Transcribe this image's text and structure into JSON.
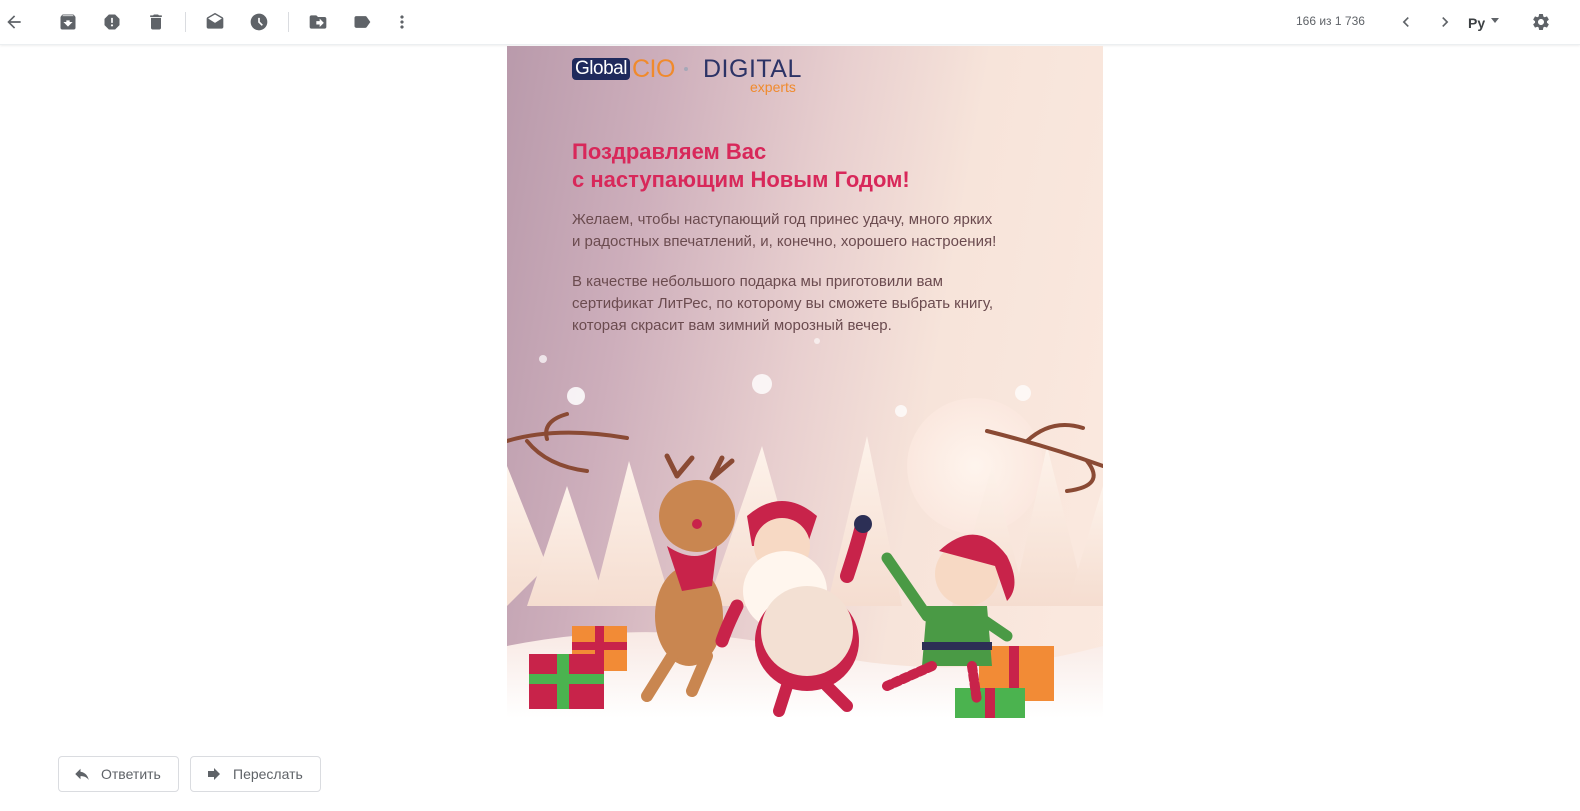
{
  "toolbar": {
    "back_icon": "arrow-back-icon",
    "archive_icon": "archive-icon",
    "spam_icon": "report-spam-icon",
    "delete_icon": "trash-icon",
    "mark_unread_icon": "mark-unread-icon",
    "snooze_icon": "clock-icon",
    "move_icon": "move-to-icon",
    "label_icon": "label-icon",
    "more_icon": "more-vert-icon",
    "counter": "166 из 1 736",
    "language": "Ру",
    "settings_icon": "gear-icon"
  },
  "email": {
    "logo": {
      "global": "Global",
      "cio": "CIO",
      "digital": "DIGITAL",
      "experts": "experts"
    },
    "greeting_line1": "Поздравляем Вас",
    "greeting_line2": "с наступающим Новым Годом!",
    "paragraph1_line1": "Желаем, чтобы наступающий год принес удачу, много ярких",
    "paragraph1_line2": "и радостных впечатлений, и, конечно, хорошего настроения!",
    "paragraph2_line1": "В качестве небольшого подарка мы приготовили вам",
    "paragraph2_line2": "сертификат ЛитРес, по которому вы сможете выбрать книгу,",
    "paragraph2_line3": "которая скрасит вам зимний морозный вечер.",
    "colors": {
      "greeting": "#d8285a",
      "body_text": "#6b4b4f",
      "logo_navy": "#1f2a5c",
      "logo_orange": "#f08a2c"
    }
  },
  "actions": {
    "reply_label": "Ответить",
    "forward_label": "Переслать"
  }
}
